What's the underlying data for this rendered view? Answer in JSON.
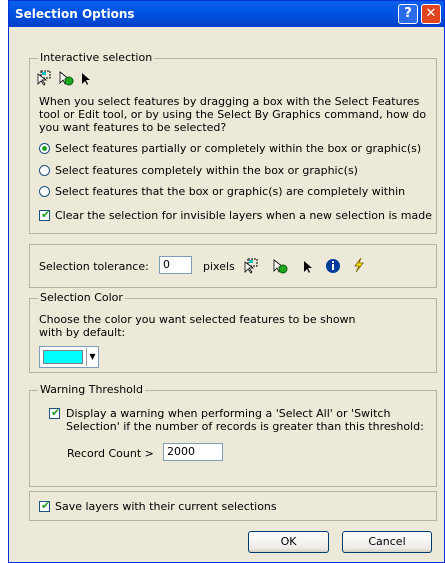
{
  "window": {
    "title": "Selection Options",
    "help_icon": "help-question-icon",
    "close_icon": "close-x-icon"
  },
  "interactive": {
    "caption": "Interactive selection",
    "icons": [
      "select-features-icon",
      "select-by-graphics-icon",
      "pointer-arrow-icon"
    ],
    "description": "When you select features by dragging a box with the Select Features tool or Edit tool, or by using the Select By Graphics command, how do you want features to be selected?",
    "options": [
      "Select features partially or completely within the box or graphic(s)",
      "Select features completely within the box or graphic(s)",
      "Select features that the box or graphic(s) are completely within"
    ],
    "selected_option": 0,
    "clear_invisible_label": "Clear the selection for invisible layers when a new selection is made",
    "clear_invisible_checked": true
  },
  "tolerance": {
    "label": "Selection tolerance:",
    "value": "0",
    "unit": "pixels",
    "icons": [
      "select-features-icon",
      "select-by-graphics-icon",
      "pointer-arrow-icon",
      "identify-info-icon",
      "hyperlink-lightning-icon"
    ]
  },
  "color": {
    "caption": "Selection Color",
    "description": "Choose the color you want selected features to be shown with by default:",
    "swatch": "#00FFFF"
  },
  "warning": {
    "caption": "Warning Threshold",
    "display_label": "Display a warning when performing a 'Select All' or 'Switch Selection' if the number of records is greater than this threshold:",
    "display_checked": true,
    "record_count_label": "Record Count >",
    "record_count_value": "2000"
  },
  "save": {
    "label": "Save layers with their current selections",
    "checked": true
  },
  "buttons": {
    "ok": "OK",
    "cancel": "Cancel"
  }
}
